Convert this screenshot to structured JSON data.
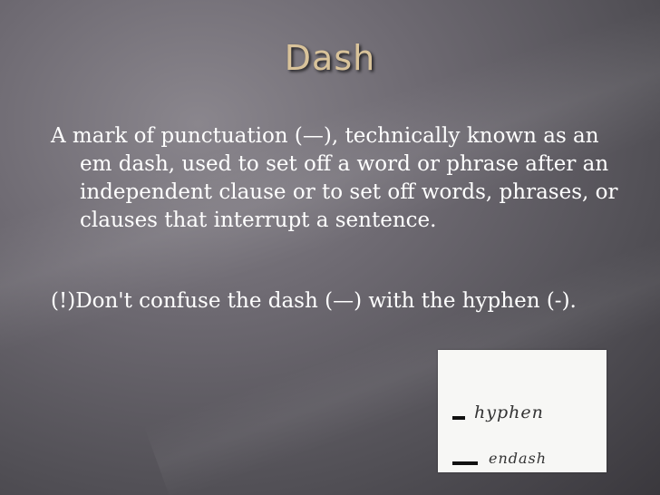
{
  "slide": {
    "title": "Dash",
    "paragraph1": "A mark of punctuation (—), technically known as an em dash, used to set off a word or phrase after an independent clause or to set off words, phrases, or clauses that interrupt a sentence.",
    "paragraph2": "(!)Don't confuse the dash (—) with the hyphen (-).",
    "image": {
      "word1": "hyphen",
      "word2": "endash"
    }
  },
  "colors": {
    "title": "#d9c39a",
    "text": "#ffffff",
    "background": "#6e6a72"
  }
}
